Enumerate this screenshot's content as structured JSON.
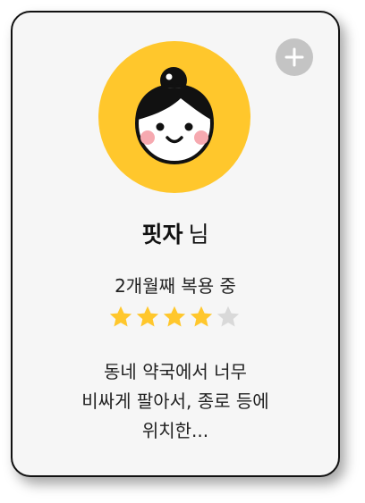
{
  "review_card": {
    "name": "핏자",
    "name_suffix": "님",
    "duration": "2개월째 복용 중",
    "rating": 4,
    "rating_max": 5,
    "review_text": "동네 약국에서 너무\n비싸게 팔아서, 종로 등에\n위치한...",
    "add_button_icon": "plus-icon",
    "avatar_icon": "smiling-face-avatar-icon"
  },
  "colors": {
    "star_filled": "#FFC72C",
    "star_empty": "#D9D9D9",
    "avatar_bg": "#FFC72C",
    "add_button_bg": "#C4C4C4"
  }
}
